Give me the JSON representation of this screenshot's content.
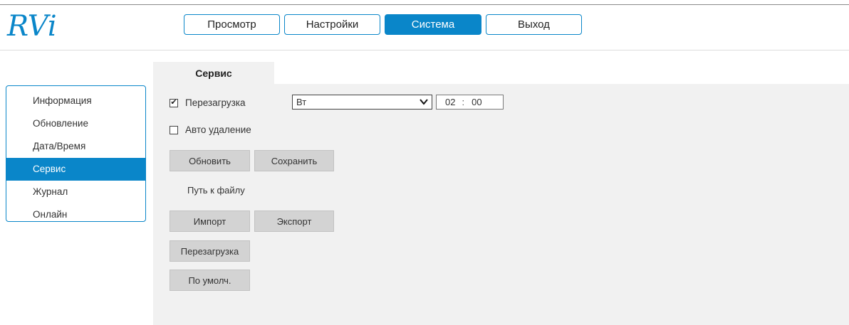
{
  "brand": {
    "logo_text": "RVi"
  },
  "nav": {
    "items": [
      {
        "label": "Просмотр"
      },
      {
        "label": "Настройки"
      },
      {
        "label": "Система"
      },
      {
        "label": "Выход"
      }
    ]
  },
  "sidebar": {
    "items": [
      {
        "label": "Информация"
      },
      {
        "label": "Обновление"
      },
      {
        "label": "Дата/Время"
      },
      {
        "label": "Сервис"
      },
      {
        "label": "Журнал"
      },
      {
        "label": "Онлайн"
      }
    ]
  },
  "main": {
    "tab_label": "Сервис",
    "reboot": {
      "label": "Перезагрузка",
      "checked": true,
      "check_glyph": "✔",
      "day": "Вт",
      "hour": "02",
      "minute": "00",
      "separator": ":"
    },
    "auto_delete": {
      "label": "Авто удаление",
      "checked": false
    },
    "buttons": {
      "refresh": "Обновить",
      "save": "Сохранить",
      "import": "Импорт",
      "export": "Экспорт",
      "reboot": "Перезагрузка",
      "defaults": "По умолч."
    },
    "file_path_label": "Путь к файлу"
  },
  "colors": {
    "accent": "#0a86c9",
    "panel": "#f1f1f1",
    "button": "#d3d3d3"
  }
}
